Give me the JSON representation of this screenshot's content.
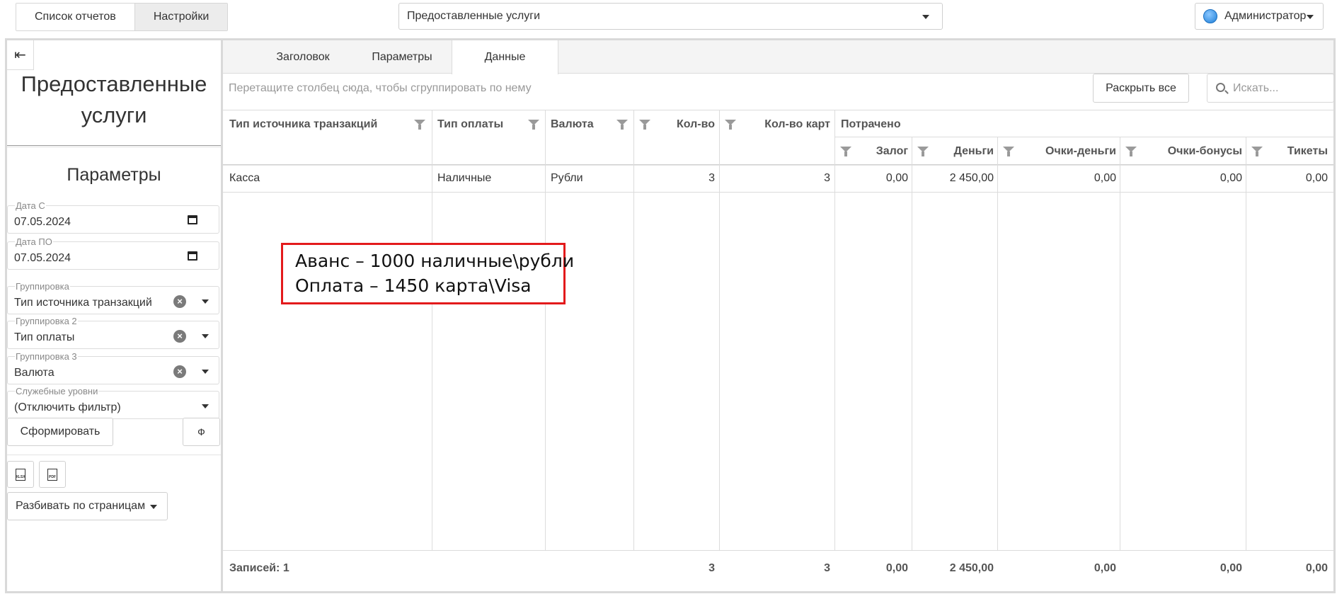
{
  "topbar": {
    "report_list_label": "Список отчетов",
    "settings_label": "Настройки",
    "report_select_value": "Предоставленные услуги",
    "user_label": "Администратор"
  },
  "sidebar": {
    "title": "Предоставленные услуги",
    "params_title": "Параметры",
    "date_from": {
      "label": "Дата С",
      "value": "07.05.2024"
    },
    "date_to": {
      "label": "Дата ПО",
      "value": "07.05.2024"
    },
    "grouping1": {
      "label": "Группировка",
      "value": "Тип источника транзакций"
    },
    "grouping2": {
      "label": "Группировка 2",
      "value": "Тип оплаты"
    },
    "grouping3": {
      "label": "Группировка 3",
      "value": "Валюта"
    },
    "service_levels": {
      "label": "Служебные уровни",
      "value": "(Отключить фильтр)"
    },
    "generate_label": "Сформировать",
    "filter_label": "Ф",
    "export_xlsx": "XLSX",
    "export_pdf": "PDF",
    "paging_label": "Разбивать по страницам"
  },
  "tabs": [
    "Заголовок",
    "Параметры",
    "Данные"
  ],
  "active_tab": "Данные",
  "toolbar": {
    "group_hint": "Перетащите столбец сюда, чтобы сгруппировать по нему",
    "expand_all": "Раскрыть все",
    "search_placeholder": "Искать..."
  },
  "grid": {
    "columns": {
      "source_type": "Тип источника транзакций",
      "payment_type": "Тип оплаты",
      "currency": "Валюта",
      "count": "Кол-во",
      "card_count": "Кол-во карт",
      "spent": "Потрачено",
      "deposit": "Залог",
      "money": "Деньги",
      "points_money": "Очки-деньги",
      "points_bonus": "Очки-бонусы",
      "tickets": "Тикеты"
    },
    "rows": [
      {
        "source_type": "Касса",
        "payment_type": "Наличные",
        "currency": "Рубли",
        "count": "3",
        "card_count": "3",
        "deposit": "0,00",
        "money": "2 450,00",
        "points_money": "0,00",
        "points_bonus": "0,00",
        "tickets": "0,00"
      }
    ],
    "footer": {
      "records": "Записей: 1",
      "count": "3",
      "card_count": "3",
      "deposit": "0,00",
      "money": "2 450,00",
      "points_money": "0,00",
      "points_bonus": "0,00",
      "tickets": "0,00"
    }
  },
  "annotation": {
    "line1": "Аванс – 1000 наличные\\рубли",
    "line2": "Оплата – 1450 карта\\Visa",
    "border_color": "#e31a1c"
  }
}
